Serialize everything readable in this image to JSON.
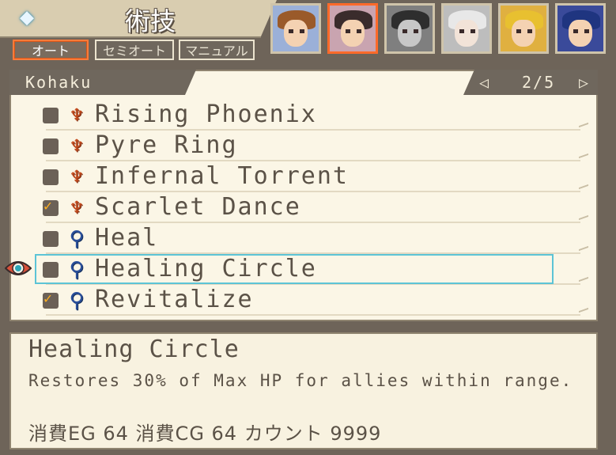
{
  "header": {
    "title": "術技",
    "icon": "diamond-icon"
  },
  "modes": [
    {
      "label": "オート",
      "active": true
    },
    {
      "label": "セミオート",
      "active": false
    },
    {
      "label": "マニュアル",
      "active": false
    }
  ],
  "party": [
    {
      "name": "portrait-1",
      "active": false
    },
    {
      "name": "portrait-2",
      "active": true
    },
    {
      "name": "portrait-3",
      "active": false
    },
    {
      "name": "portrait-4",
      "active": false
    },
    {
      "name": "portrait-5",
      "active": false
    },
    {
      "name": "portrait-6",
      "active": false
    }
  ],
  "character": {
    "name": "Kohaku"
  },
  "pager": {
    "text": "2/5",
    "prev": "◁",
    "next": "▷"
  },
  "skills": [
    {
      "name": "Rising Phoenix",
      "checked": false,
      "icon": "fire-emblem-icon"
    },
    {
      "name": "Pyre Ring",
      "checked": false,
      "icon": "fire-emblem-icon"
    },
    {
      "name": "Infernal Torrent",
      "checked": false,
      "icon": "fire-emblem-icon"
    },
    {
      "name": "Scarlet Dance",
      "checked": true,
      "icon": "fire-emblem-icon"
    },
    {
      "name": "Heal",
      "checked": false,
      "icon": "staff-icon"
    },
    {
      "name": "Healing Circle",
      "checked": false,
      "icon": "staff-icon",
      "selected": true
    },
    {
      "name": "Revitalize",
      "checked": true,
      "icon": "staff-icon"
    }
  ],
  "description": {
    "title": "Healing Circle",
    "text": "Restores 30% of Max HP for allies within range.",
    "cost": "消費EG 64 消費CG 64 カウント 9999"
  }
}
